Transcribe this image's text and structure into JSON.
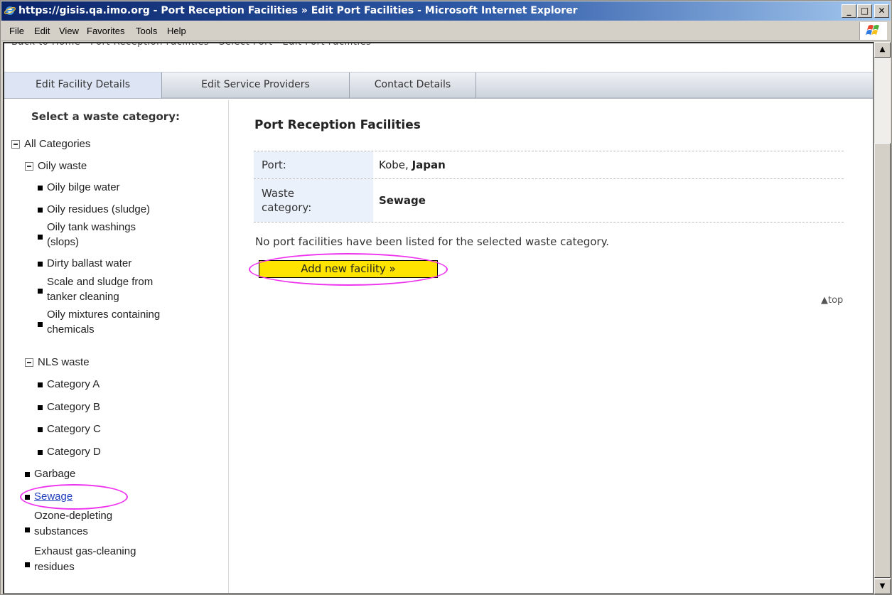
{
  "window": {
    "title": "https://gisis.qa.imo.org - Port Reception Facilities » Edit Port Facilities - Microsoft Internet Explorer",
    "minimize": "_",
    "maximize": "□",
    "close": "✕"
  },
  "menu": {
    "file": "File",
    "edit": "Edit",
    "view": "View",
    "favorites": "Favorites",
    "tools": "Tools",
    "help": "Help"
  },
  "breadcrumb_cut": "Back to Home · Port Reception Facilities · Select Port · Edit Port Facilities",
  "tabs": {
    "facility": "Edit Facility Details",
    "providers": "Edit Service Providers",
    "contact": "Contact Details"
  },
  "sidebar": {
    "heading": "Select a waste category:",
    "all": "All Categories",
    "oily": "Oily waste",
    "oily_bilge": "Oily bilge water",
    "oily_residues": "Oily residues (sludge)",
    "oily_tank_1": "Oily tank washings",
    "oily_tank_2": "(slops)",
    "dirty_ballast": "Dirty ballast water",
    "scale_1": "Scale and sludge from",
    "scale_2": "tanker cleaning",
    "oily_mix_1": "Oily mixtures containing",
    "oily_mix_2": "chemicals",
    "nls": "NLS waste",
    "cat_a": "Category A",
    "cat_b": "Category B",
    "cat_c": "Category C",
    "cat_d": "Category D",
    "garbage": "Garbage",
    "sewage": "Sewage",
    "ozone_1": "Ozone-depleting",
    "ozone_2": "substances",
    "exhaust_1": "Exhaust gas-cleaning",
    "exhaust_2": "residues"
  },
  "main": {
    "title": "Port Reception Facilities",
    "port_label": "Port:",
    "port_city": "Kobe,",
    "port_country": "Japan",
    "waste_label_1": "Waste",
    "waste_label_2": "category:",
    "waste_value": "Sewage",
    "message": "No port facilities have been listed for the selected waste category.",
    "add_button": "Add new facility »",
    "top_link": "▲top"
  },
  "colors": {
    "highlight_oval": "#ee33ee",
    "add_button_bg": "#ffe400",
    "active_tab_bg": "#dde5f5",
    "link": "#1f3fbf"
  },
  "scrollbar": {
    "up": "▲",
    "down": "▼"
  }
}
